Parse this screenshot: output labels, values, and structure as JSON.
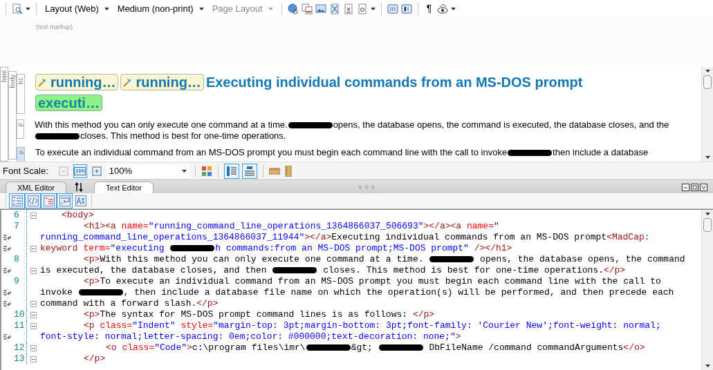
{
  "toolbar": {
    "menus": [
      {
        "label": "Layout (Web)",
        "disabled": false
      },
      {
        "label": "Medium (non-print)",
        "disabled": false
      },
      {
        "label": "Page Layout",
        "disabled": true
      }
    ],
    "pilcrow": "¶"
  },
  "markup_hint": "(text markup)",
  "preview": {
    "outer_tags": [
      "html",
      "body"
    ],
    "blocks": [
      {
        "kind": "heading",
        "tag": "h1",
        "selected": false,
        "markers": [
          {
            "kind": "anchor",
            "label": "running…",
            "color": "#f9f7cf"
          },
          {
            "kind": "anchor",
            "label": "running…",
            "color": "#f9f7cf"
          },
          {
            "kind": "keyword",
            "label": "executi…",
            "color": "#8ff08a"
          }
        ],
        "text": "Executing individual commands from an MS-DOS prompt"
      },
      {
        "kind": "paragraph",
        "tag": "p",
        "selected": false,
        "segments": [
          {
            "kind": "text",
            "text": "With this method you can only execute one command at a time."
          },
          {
            "kind": "redacted"
          },
          {
            "kind": "text",
            "text": "opens, the database opens, the command is executed, the database closes, and the"
          },
          {
            "kind": "redacted"
          },
          {
            "kind": "text",
            "text": "closes. This method is best for one-time operations."
          }
        ]
      },
      {
        "kind": "paragraph",
        "tag": "p",
        "selected": true,
        "segments": [
          {
            "kind": "text",
            "text": "To execute an individual command from an MS-DOS prompt you must begin each command line with the call to invoke"
          },
          {
            "kind": "redacted"
          },
          {
            "kind": "text",
            "text": "then include a database"
          }
        ]
      }
    ]
  },
  "font_scale": {
    "label": "Font Scale:",
    "buttons": [
      {
        "kind": "minus",
        "disabled": true,
        "on": false
      },
      {
        "kind": "reset",
        "label": "100",
        "disabled": false,
        "on": true
      },
      {
        "kind": "plus",
        "disabled": false,
        "on": false
      }
    ],
    "zoom": "100%",
    "layout_toggles": [
      {
        "kind": "side",
        "on": true
      },
      {
        "kind": "top",
        "on": true
      }
    ]
  },
  "tabs": [
    {
      "label": "XML Editor",
      "selected": false
    },
    {
      "label": "Text Editor",
      "selected": true
    }
  ],
  "editor_tools": [
    {
      "kind": "numbers",
      "on": true
    },
    {
      "kind": "tags",
      "on": true
    },
    {
      "kind": "colors",
      "on": true
    },
    {
      "kind": "wrap",
      "on": true
    },
    {
      "kind": "font",
      "on": false
    }
  ],
  "code_lines": [
    {
      "number": "6",
      "wrapped": false,
      "fold": true,
      "kind": "outer",
      "segments": [
        {
          "kind": "tag",
          "text": "<body>"
        }
      ]
    },
    {
      "number": "7",
      "wrapped": false,
      "fold": false,
      "kind": "inner",
      "segments": [
        {
          "kind": "tag",
          "text": "<h1><a "
        },
        {
          "kind": "attr",
          "text": "name="
        },
        {
          "kind": "value",
          "text": "\"running_command_line_operations_1364866037_506693\""
        },
        {
          "kind": "tag",
          "text": "></a><a "
        },
        {
          "kind": "attr",
          "text": "name="
        },
        {
          "kind": "value",
          "text": "\""
        }
      ]
    },
    {
      "wrapped": true,
      "fold": false,
      "kind": "continued",
      "segments": [
        {
          "kind": "value",
          "text": "running_command_line_operations_1364866037_11944\""
        },
        {
          "kind": "tag",
          "text": "></a>"
        },
        {
          "kind": "text",
          "text": "Executing individual commands from an MS-DOS prompt"
        },
        {
          "kind": "tag",
          "text": "<MadCap:"
        }
      ]
    },
    {
      "wrapped": true,
      "fold": true,
      "kind": "continued",
      "segments": [
        {
          "kind": "tag",
          "text": "keyword "
        },
        {
          "kind": "attr",
          "text": "term="
        },
        {
          "kind": "value",
          "text": "\"executing "
        },
        {
          "kind": "redacted"
        },
        {
          "kind": "value",
          "text": "h commands:from an MS-DOS prompt;MS-DOS prompt\" "
        },
        {
          "kind": "tag",
          "text": "/></h1>"
        }
      ]
    },
    {
      "number": "8",
      "wrapped": false,
      "fold": false,
      "kind": "inner",
      "segments": [
        {
          "kind": "tag",
          "text": "<p>"
        },
        {
          "kind": "text",
          "text": "With this method you can only execute one command at a time. "
        },
        {
          "kind": "redacted"
        },
        {
          "kind": "text",
          "text": " opens, the database opens, the command"
        }
      ]
    },
    {
      "wrapped": true,
      "fold": true,
      "kind": "continued",
      "segments": [
        {
          "kind": "text",
          "text": "is executed, the database closes, and then "
        },
        {
          "kind": "redacted"
        },
        {
          "kind": "text",
          "text": " closes. This method is best for one-time operations."
        },
        {
          "kind": "tag",
          "text": "</p>"
        }
      ]
    },
    {
      "number": "9",
      "wrapped": false,
      "fold": false,
      "kind": "inner",
      "segments": [
        {
          "kind": "tag",
          "text": "<p>"
        },
        {
          "kind": "text",
          "text": "To execute an individual command from an MS-DOS prompt you must begin each command line with the call to"
        }
      ]
    },
    {
      "wrapped": true,
      "fold": false,
      "kind": "continued",
      "segments": [
        {
          "kind": "text",
          "text": "invoke "
        },
        {
          "kind": "redacted"
        },
        {
          "kind": "text",
          "text": ", then include a database file name on which the operation(s) will be performed, and then precede each"
        }
      ]
    },
    {
      "wrapped": true,
      "fold": true,
      "kind": "continued",
      "segments": [
        {
          "kind": "text",
          "text": "command with a forward slash."
        },
        {
          "kind": "tag",
          "text": "</p>"
        }
      ]
    },
    {
      "number": "10",
      "wrapped": false,
      "fold": true,
      "kind": "inner",
      "segments": [
        {
          "kind": "tag",
          "text": "<p>"
        },
        {
          "kind": "text",
          "text": "The syntax for MS-DOS prompt command lines is as follows: "
        },
        {
          "kind": "tag",
          "text": "</p>"
        }
      ]
    },
    {
      "number": "11",
      "wrapped": false,
      "fold": true,
      "kind": "inner",
      "segments": [
        {
          "kind": "tag",
          "text": "<p "
        },
        {
          "kind": "attr",
          "text": "class="
        },
        {
          "kind": "value",
          "text": "\"Indent\" "
        },
        {
          "kind": "attr",
          "text": "style="
        },
        {
          "kind": "value",
          "text": "\"margin-top: 3pt;margin-bottom: 3pt;font-family: 'Courier New';font-weight: normal;"
        }
      ]
    },
    {
      "wrapped": true,
      "fold": false,
      "kind": "continued",
      "segments": [
        {
          "kind": "value",
          "text": "font-style: normal;letter-spacing: 0em;color: #000000;text-decoration: none;\""
        },
        {
          "kind": "tag",
          "text": ">"
        }
      ]
    },
    {
      "number": "12",
      "wrapped": false,
      "fold": true,
      "kind": "innermost",
      "segments": [
        {
          "kind": "tag",
          "text": "<o "
        },
        {
          "kind": "attr",
          "text": "class="
        },
        {
          "kind": "value",
          "text": "\"Code\""
        },
        {
          "kind": "tag",
          "text": ">"
        },
        {
          "kind": "text",
          "text": "c:\\program files\\imr\\"
        },
        {
          "kind": "redacted"
        },
        {
          "kind": "text",
          "text": "&gt; "
        },
        {
          "kind": "redacted"
        },
        {
          "kind": "text",
          "text": " DbFileName /command commandArguments"
        },
        {
          "kind": "tag",
          "text": "</o>"
        }
      ]
    },
    {
      "number": "13",
      "wrapped": false,
      "fold": true,
      "kind": "inner",
      "segments": [
        {
          "kind": "tag",
          "text": "</p>"
        }
      ]
    }
  ]
}
